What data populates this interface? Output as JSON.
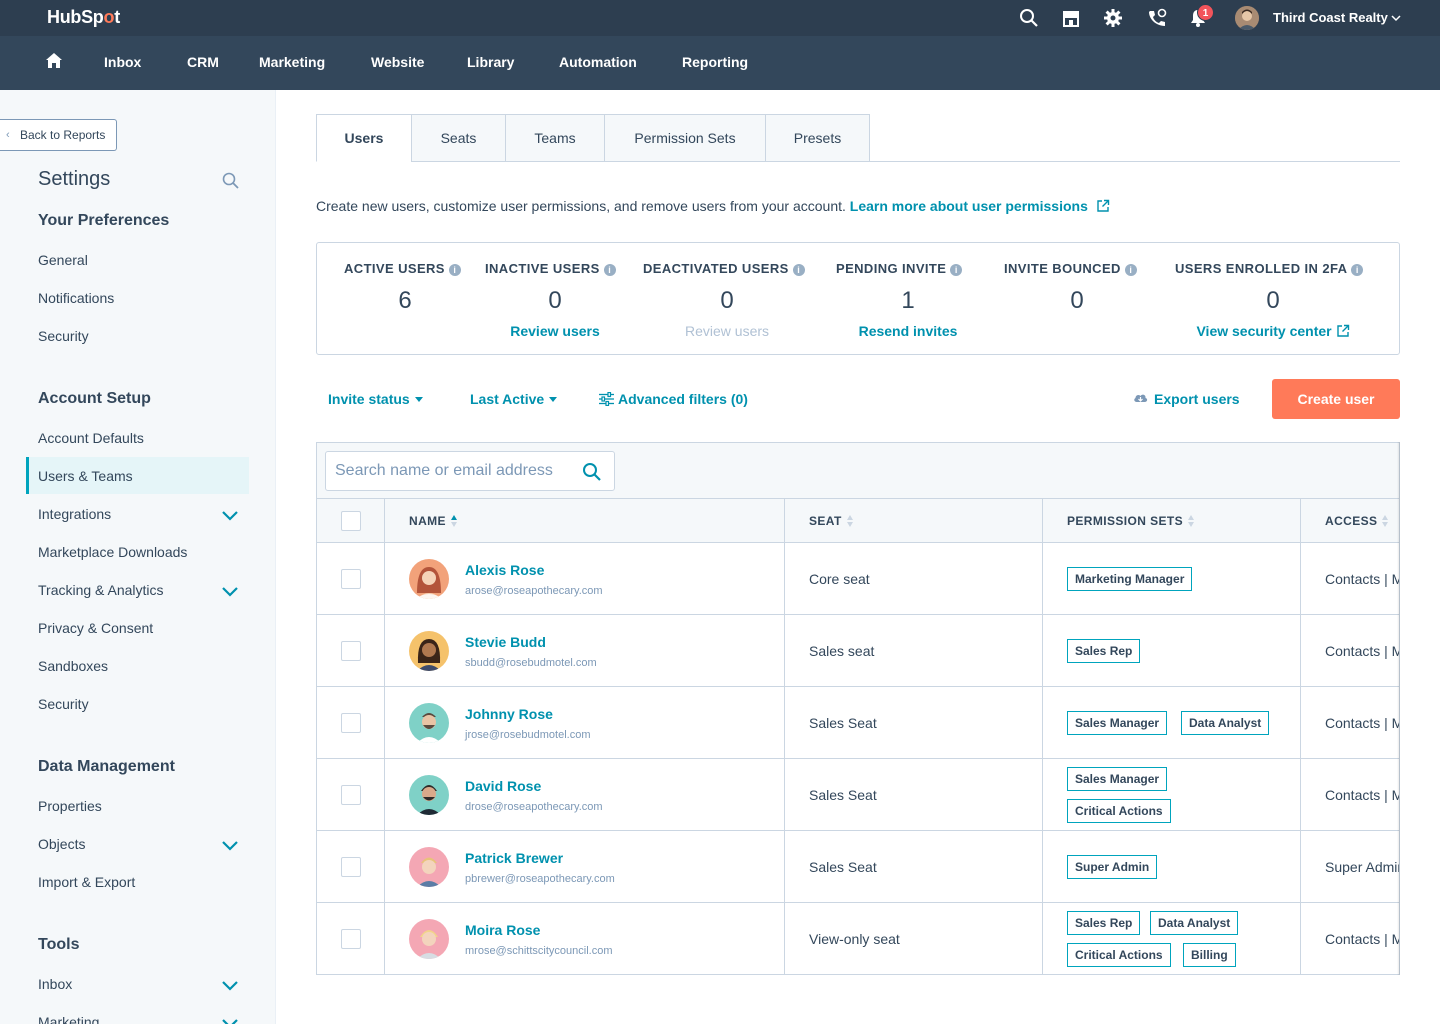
{
  "topbar": {
    "logo_pre": "HubSp",
    "logo_o": "o",
    "logo_post": "t",
    "notification_count": "1",
    "account_name": "Third Coast Realty"
  },
  "nav": {
    "items": [
      "Inbox",
      "CRM",
      "Marketing",
      "Website",
      "Library",
      "Automation",
      "Reporting"
    ]
  },
  "sidebar": {
    "back_label": "Back to Reports",
    "title": "Settings",
    "sections": [
      {
        "title": "Your Preferences",
        "items": [
          "General",
          "Notifications",
          "Security"
        ]
      },
      {
        "title": "Account Setup",
        "items": [
          "Account Defaults",
          "Users & Teams",
          "Integrations",
          "Marketplace Downloads",
          "Tracking & Analytics",
          "Privacy & Consent",
          "Sandboxes",
          "Security"
        ]
      },
      {
        "title": "Data Management",
        "items": [
          "Properties",
          "Objects",
          "Import & Export"
        ]
      },
      {
        "title": "Tools",
        "items": [
          "Inbox",
          "Marketing"
        ]
      }
    ],
    "active_item": "Users & Teams"
  },
  "tabs": [
    "Users",
    "Seats",
    "Teams",
    "Permission Sets",
    "Presets"
  ],
  "description": {
    "text": "Create new users, customize user permissions, and remove users from your account.",
    "link": "Learn more about user permissions"
  },
  "stats": [
    {
      "label": "ACTIVE USERS",
      "value": "6",
      "link": ""
    },
    {
      "label": "INACTIVE USERS",
      "value": "0",
      "link": "Review users"
    },
    {
      "label": "DEACTIVATED USERS",
      "value": "0",
      "link": "Review users"
    },
    {
      "label": "PENDING INVITE",
      "value": "1",
      "link": "Resend invites"
    },
    {
      "label": "INVITE BOUNCED",
      "value": "0",
      "link": ""
    },
    {
      "label": "USERS ENROLLED IN 2FA",
      "value": "0",
      "link": "View security center"
    }
  ],
  "filters": {
    "invite_status": "Invite status",
    "last_active": "Last Active",
    "advanced": "Advanced filters (0)",
    "export": "Export users",
    "create": "Create user"
  },
  "table": {
    "search_placeholder": "Search name or email address",
    "columns": [
      "NAME",
      "SEAT",
      "PERMISSION SETS",
      "ACCESS"
    ],
    "rows": [
      {
        "name": "Alexis Rose",
        "email": "arose@roseapothecary.com",
        "seat": "Core seat",
        "permissions": [
          "Marketing Manager"
        ],
        "access": "Contacts | M"
      },
      {
        "name": "Stevie Budd",
        "email": "sbudd@rosebudmotel.com",
        "seat": "Sales seat",
        "permissions": [
          "Sales Rep"
        ],
        "access": "Contacts | M"
      },
      {
        "name": "Johnny Rose",
        "email": "jrose@rosebudmotel.com",
        "seat": "Sales Seat",
        "permissions": [
          "Sales Manager",
          "Data Analyst"
        ],
        "access": "Contacts | M"
      },
      {
        "name": "David Rose",
        "email": "drose@roseapothecary.com",
        "seat": "Sales Seat",
        "permissions": [
          "Sales Manager",
          "Critical Actions"
        ],
        "access": "Contacts | M"
      },
      {
        "name": "Patrick Brewer",
        "email": "pbrewer@roseapothecary.com",
        "seat": "Sales Seat",
        "permissions": [
          "Super Admin"
        ],
        "access": "Super Admin"
      },
      {
        "name": "Moira Rose",
        "email": "mrose@schittscitycouncil.com",
        "seat": "View-only seat",
        "permissions": [
          "Sales Rep",
          "Data Analyst",
          "Critical Actions",
          "Billing"
        ],
        "access": "Contacts | M"
      }
    ]
  },
  "colors": {
    "accent": "#0091ae",
    "brand_orange": "#ff7a59",
    "topbar": "#2d3e50",
    "navbar": "#33475b"
  }
}
